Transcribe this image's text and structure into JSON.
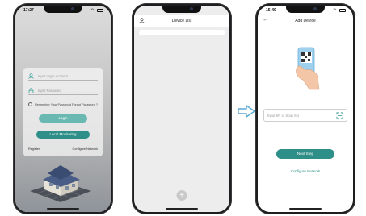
{
  "login_screen": {
    "status_time": "17:27",
    "account_placeholder": "Input Login Account",
    "password_placeholder": "Input Password",
    "remember_label": "Remember Your Password",
    "forgot_label": "Forgot Password ?",
    "login_button": "Login",
    "local_button": "Local Monitoring",
    "register_link": "Register",
    "configure_link": "Configure Network"
  },
  "device_list_screen": {
    "title": "Device List",
    "user_icon": "user-icon",
    "add_icon": "plus-icon"
  },
  "add_device_screen": {
    "status_time": "15:40",
    "title": "Add Device",
    "sn_placeholder": "Input SN or Scan SN",
    "next_button": "Next Step",
    "configure_link": "Configure Network",
    "scan_icon": "scan-icon"
  },
  "flow_arrow": "arrow-right-icon",
  "colors": {
    "accent": "#2e8f88",
    "accent_light": "#6ab8b2",
    "arrow": "#5aa9d6"
  }
}
